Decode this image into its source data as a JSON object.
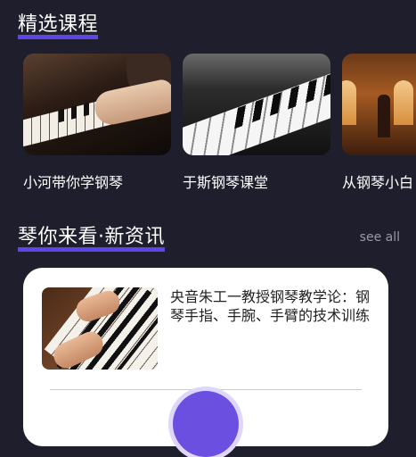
{
  "sections": {
    "featured": {
      "title": "精选课程"
    },
    "news": {
      "title": "琴你来看·新资讯",
      "see_all_label": "see all"
    }
  },
  "courses": [
    {
      "name": "小河带你学钢琴"
    },
    {
      "name": "于斯钢琴课堂"
    },
    {
      "name": "从钢琴小白"
    }
  ],
  "news_items": [
    {
      "title": "央音朱工一教授钢琴教学论：钢琴手指、手腕、手臂的技术训练"
    }
  ],
  "colors": {
    "background": "#1f1e2c",
    "accent": "#5b47e6",
    "card": "#ffffff"
  }
}
